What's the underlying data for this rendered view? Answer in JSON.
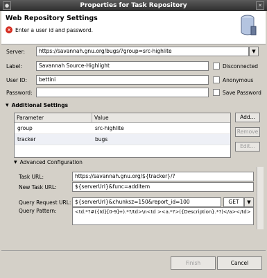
{
  "window": {
    "title": "Properties for Task Repository"
  },
  "header": {
    "title": "Web Repository Settings",
    "error": "Enter a user id and password."
  },
  "form": {
    "server_label": "Server:",
    "server_value": "https://savannah.gnu.org/bugs/?group=src-highlite",
    "label_label": "Label:",
    "label_value": "Savannah Source-Highlight",
    "userid_label": "User ID:",
    "userid_value": "bettini",
    "password_label": "Password:",
    "password_value": "",
    "disconnected_label": "Disconnected",
    "anonymous_label": "Anonymous",
    "save_password_label": "Save Password"
  },
  "additional": {
    "title": "Additional Settings",
    "columns": [
      "Parameter",
      "Value"
    ],
    "rows": [
      {
        "parameter": "group",
        "value": "src-highlite"
      },
      {
        "parameter": "tracker",
        "value": "bugs"
      }
    ],
    "add_label": "Add...",
    "remove_label": "Remove",
    "edit_label": "Edit..."
  },
  "advanced": {
    "title": "Advanced Configuration",
    "task_url_label": "Task URL:",
    "task_url_value": "https://savannah.gnu.org/${tracker}/?",
    "new_task_url_label": "New Task URL:",
    "new_task_url_value": "${serverUrl}&func=additem",
    "query_request_label": "Query Request URL:",
    "query_request_value": "${serverUrl}&chunksz=150&report_id=100",
    "method_value": "GET",
    "query_pattern_label": "Query Pattern:",
    "query_pattern_value": "<td.*?#({Id}[0-9]+).*?/td>\\n<td ><a.*?>({Description}.*?)</a></td>"
  },
  "footer": {
    "finish_label": "Finish",
    "cancel_label": "Cancel"
  }
}
